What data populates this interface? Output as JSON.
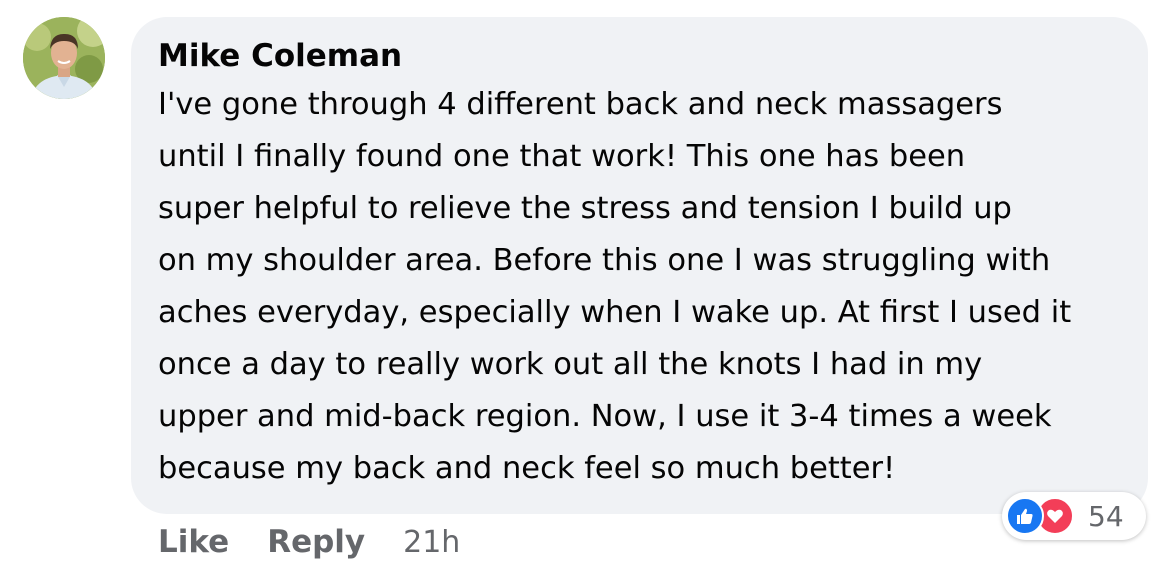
{
  "comment": {
    "author": "Mike Coleman",
    "text": "I've gone through 4 different back and neck massagers\nuntil I finally found one that work! This one has been\nsuper helpful to relieve the stress and tension I build up\non my shoulder area. Before this one I was struggling with\naches everyday, especially when I wake up. At first I used it\nonce a day to really work out all the knots I had in my\nupper and mid-back region. Now, I use it 3-4 times a week\nbecause my back and neck feel so much better!",
    "actions": {
      "like_label": "Like",
      "reply_label": "Reply",
      "timestamp": "21h"
    },
    "reactions": {
      "icons": [
        "like-icon",
        "love-icon"
      ],
      "count": "54"
    }
  },
  "colors": {
    "bubble": "#f0f2f5",
    "muted_text": "#65676b",
    "like_blue": "#1877f2",
    "love_red": "#f33e58"
  }
}
